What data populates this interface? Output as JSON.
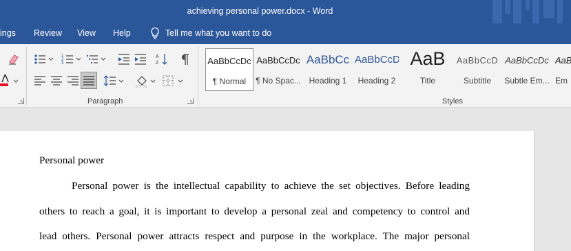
{
  "window": {
    "title": "achieving personal power.docx  -  Word"
  },
  "tabs": [
    "ings",
    "Review",
    "View",
    "Help"
  ],
  "tell_me": {
    "placeholder": "Tell me what you want to do",
    "icon": "lightbulb-icon"
  },
  "groups": {
    "paragraph": "Paragraph",
    "styles": "Styles"
  },
  "styles": [
    {
      "preview": "AaBbCcDc",
      "name": "¶ Normal",
      "selected": true
    },
    {
      "preview": "AaBbCcDc",
      "name": "¶ No Spac..."
    },
    {
      "preview": "AaBbCc",
      "name": "Heading 1"
    },
    {
      "preview": "AaBbCcD",
      "name": "Heading 2"
    },
    {
      "preview": "AaB",
      "name": "Title"
    },
    {
      "preview": "AaBbCcD",
      "name": "Subtitle"
    },
    {
      "preview": "AaBbCcDc",
      "name": "Subtle Em..."
    },
    {
      "preview": "AaB",
      "name": "Em"
    }
  ],
  "colors": {
    "ribbon_blue": "#2b579a",
    "heading_blue": "#2e5597",
    "font_color_red": "#e81123"
  },
  "document": {
    "heading": "Personal power",
    "lines": [
      "Personal power is the intellectual capability to achieve the set objectives. Before leading",
      "others to reach a goal, it is important to develop a personal zeal and competency to control and",
      "lead others. Personal power attracts respect and purpose in the workplace. The major personal"
    ]
  }
}
